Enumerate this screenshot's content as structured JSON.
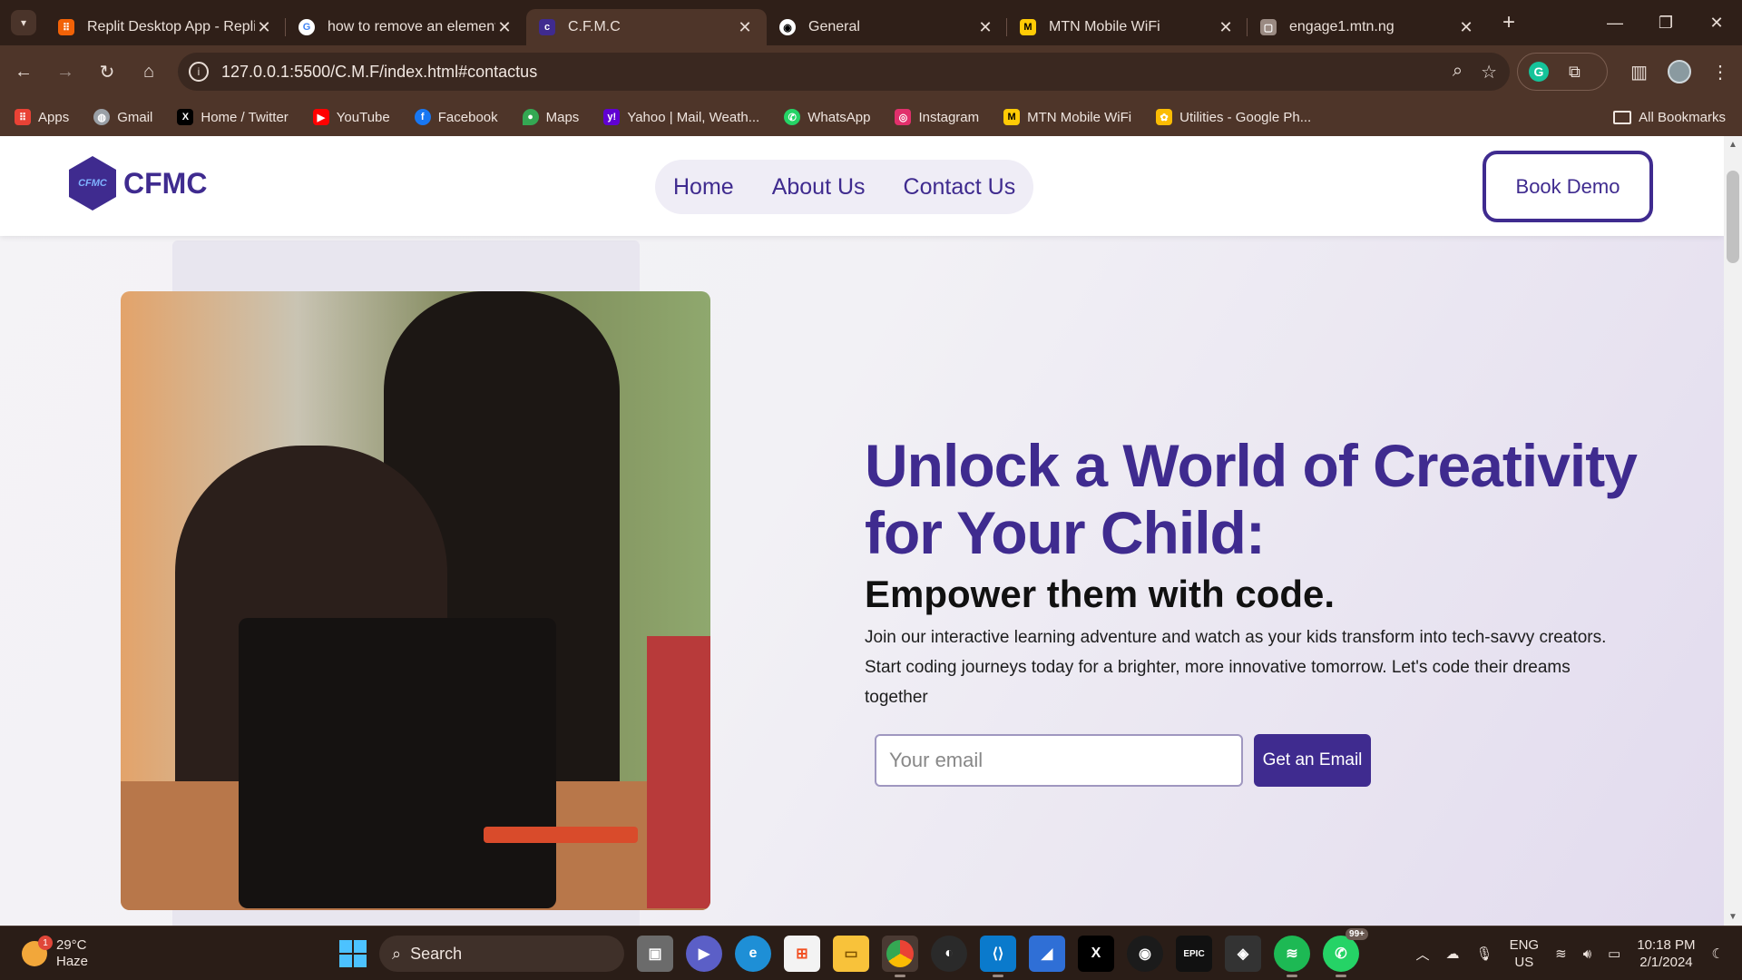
{
  "browser": {
    "tabs": [
      {
        "title": "Replit Desktop App - Replit",
        "favicon": "replit-icon",
        "color": "#f26207",
        "active": false
      },
      {
        "title": "how to remove an element",
        "favicon": "google-icon",
        "color": "#ffffff",
        "active": false
      },
      {
        "title": "C.F.M.C",
        "favicon": "cfmc-icon",
        "color": "#3f2b8f",
        "active": true
      },
      {
        "title": "General",
        "favicon": "github-icon",
        "color": "#ffffff",
        "active": false
      },
      {
        "title": "MTN Mobile WiFi",
        "favicon": "mtn-icon",
        "color": "#ffcb05",
        "active": false
      },
      {
        "title": "engage1.mtn.ng",
        "favicon": "page-icon",
        "color": "#9a8a82",
        "active": false
      }
    ],
    "url": "127.0.0.1:5500/C.M.F/index.html#contactus",
    "bookmarks": [
      {
        "label": "Apps",
        "icon": "apps-grid-icon",
        "color": "#e94235"
      },
      {
        "label": "Gmail",
        "icon": "globe-icon",
        "color": "#9aa0a6"
      },
      {
        "label": "Home / Twitter",
        "icon": "x-icon",
        "color": "#000000"
      },
      {
        "label": "YouTube",
        "icon": "youtube-icon",
        "color": "#ff0000"
      },
      {
        "label": "Facebook",
        "icon": "facebook-icon",
        "color": "#1877f2"
      },
      {
        "label": "Maps",
        "icon": "maps-icon",
        "color": "#34a853"
      },
      {
        "label": "Yahoo | Mail, Weath...",
        "icon": "yahoo-icon",
        "color": "#6001d2"
      },
      {
        "label": "WhatsApp",
        "icon": "whatsapp-icon",
        "color": "#25d366"
      },
      {
        "label": "Instagram",
        "icon": "instagram-icon",
        "color": "#e1306c"
      },
      {
        "label": "MTN Mobile WiFi",
        "icon": "mtn-icon",
        "color": "#ffcb05"
      },
      {
        "label": "Utilities - Google Ph...",
        "icon": "google-photos-icon",
        "color": "#fbbc04"
      }
    ],
    "all_bookmarks": "All Bookmarks"
  },
  "site": {
    "brand": "CFMC",
    "logo_text": "CFMC",
    "nav": [
      "Home",
      "About Us",
      "Contact Us"
    ],
    "cta": "Book Demo",
    "hero": {
      "heading": "Unlock a World of Creativity for Your Child:",
      "subheading": "Empower them with code.",
      "body": "Join our interactive learning adventure and watch as your kids transform into tech-savvy creators. Start coding journeys today for a brighter, more innovative tomorrow. Let's code their dreams together",
      "email_placeholder": "Your email",
      "button": "Get an Email"
    },
    "colors": {
      "brand": "#3f2b8f"
    }
  },
  "taskbar": {
    "weather_temp": "29°C",
    "weather_desc": "Haze",
    "weather_badge": "1",
    "search_label": "Search",
    "whatsapp_badge": "99+",
    "lang_top": "ENG",
    "lang_bottom": "US",
    "time": "10:18 PM",
    "date": "2/1/2024"
  }
}
